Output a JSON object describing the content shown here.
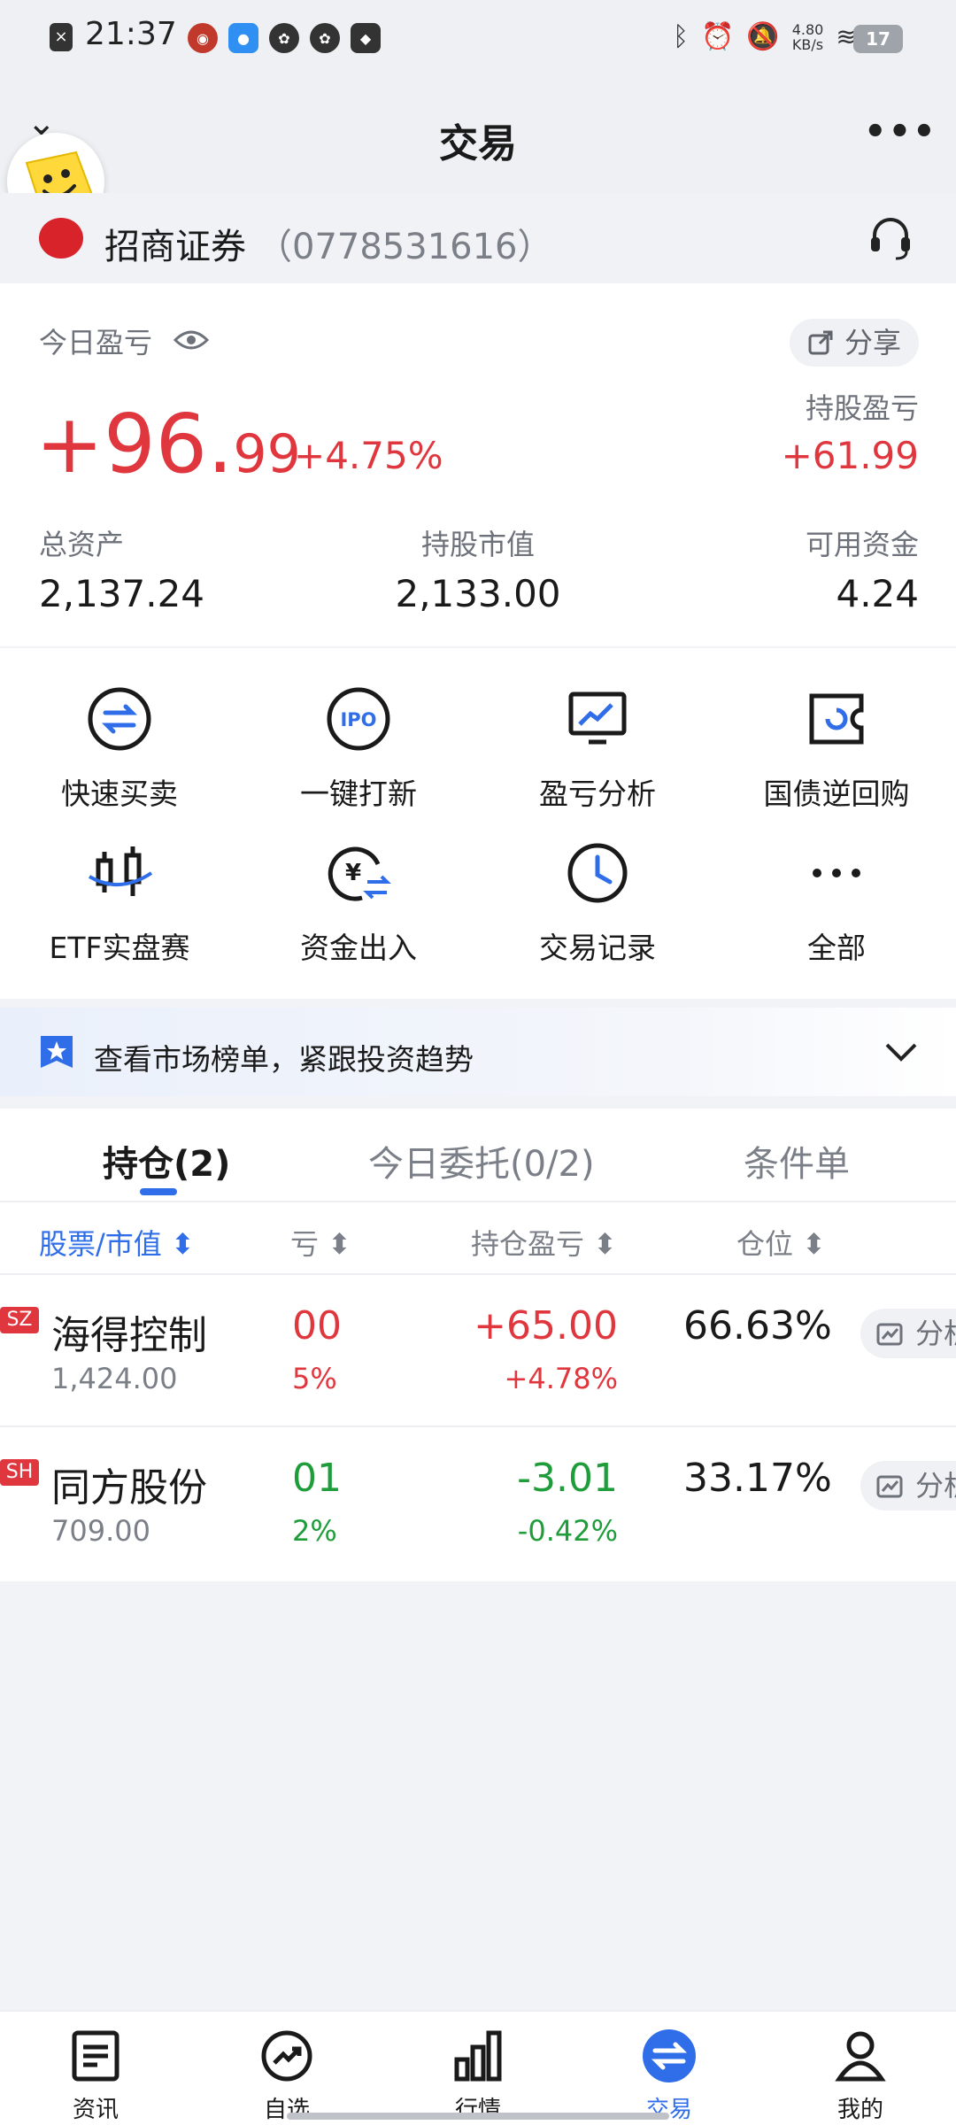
{
  "status_bar": {
    "time": "21:37",
    "net_speed_value": "4.80",
    "net_speed_unit": "KB/s",
    "battery": "17"
  },
  "header": {
    "title": "交易",
    "more_label": "•••"
  },
  "broker": {
    "name": "招商证券",
    "account": "（0778531616）"
  },
  "summary": {
    "today_label": "今日盈亏",
    "share_label": "分享",
    "today_pnl_int": "+96.",
    "today_pnl_dec": "99",
    "today_pct": "+4.75%",
    "holding_pnl_label": "持股盈亏",
    "holding_pnl_value": "+61.99",
    "total_assets_label": "总资产",
    "total_assets_value": "2,137.24",
    "market_value_label": "持股市值",
    "market_value_value": "2,133.00",
    "available_label": "可用资金",
    "available_value": "4.24"
  },
  "menu": {
    "items": [
      {
        "label": "快速买卖",
        "icon": "swap-circle-icon"
      },
      {
        "label": "一键打新",
        "icon": "ipo-icon"
      },
      {
        "label": "盈亏分析",
        "icon": "chart-monitor-icon"
      },
      {
        "label": "国债逆回购",
        "icon": "bond-repo-icon"
      },
      {
        "label": "ETF实盘赛",
        "icon": "candlestick-icon"
      },
      {
        "label": "资金出入",
        "icon": "yuan-transfer-icon"
      },
      {
        "label": "交易记录",
        "icon": "clock-icon"
      },
      {
        "label": "全部",
        "icon": "more-dots-icon"
      }
    ]
  },
  "banner": {
    "text": "查看市场榜单，紧跟投资趋势"
  },
  "positions": {
    "tabs": [
      "持仓(2)",
      "今日委托(0/2)",
      "条件单"
    ],
    "columns": [
      "股票/市值 ⬍",
      "亏 ⬍",
      "持仓盈亏 ⬍",
      "仓位 ⬍"
    ],
    "analyze_label": "分析",
    "rows": [
      {
        "market": "SZ",
        "name": "海得控制",
        "market_value": "1,424.00",
        "day_pnl": "00",
        "day_pct": "5%",
        "pnl": "+65.00",
        "pnl_pct": "+4.78%",
        "weight": "66.63%",
        "trend": "up"
      },
      {
        "market": "SH",
        "name": "同方股份",
        "market_value": "709.00",
        "day_pnl": "01",
        "day_pct": "2%",
        "pnl": "-3.01",
        "pnl_pct": "-0.42%",
        "weight": "33.17%",
        "trend": "down"
      }
    ]
  },
  "bottom_nav": [
    {
      "label": "资讯",
      "icon": "news-icon"
    },
    {
      "label": "自选",
      "icon": "trend-icon"
    },
    {
      "label": "行情",
      "icon": "bar-chart-icon"
    },
    {
      "label": "交易",
      "icon": "exchange-icon",
      "active": true
    },
    {
      "label": "我的",
      "icon": "profile-icon"
    }
  ],
  "colors": {
    "up": "#e0363e",
    "down": "#1f9d3b",
    "accent": "#2f6ee8"
  }
}
